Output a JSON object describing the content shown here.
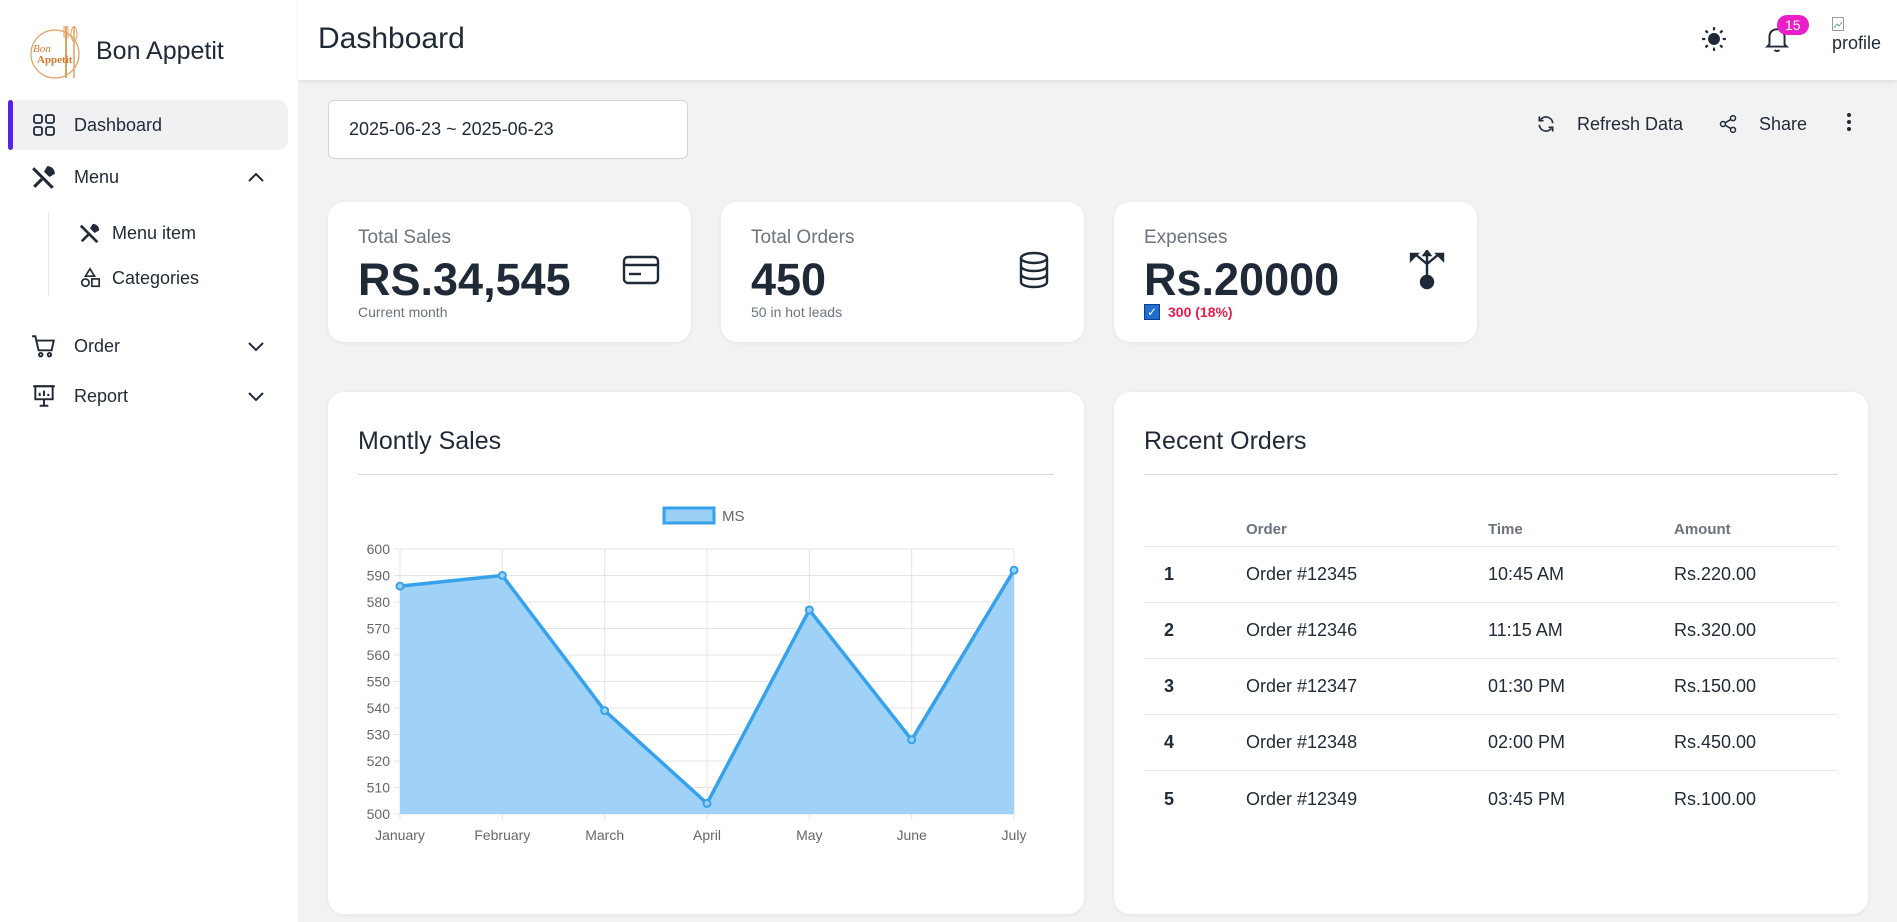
{
  "brand": {
    "name": "Bon Appetit",
    "logo_text_1": "Bon",
    "logo_text_2": "Appetit"
  },
  "sidebar": {
    "items": [
      {
        "label": "Dashboard",
        "icon": "grid-icon",
        "active": true
      },
      {
        "label": "Menu",
        "icon": "utensils-icon",
        "expanded": true
      },
      {
        "label": "Order",
        "icon": "cart-icon",
        "expanded": false
      },
      {
        "label": "Report",
        "icon": "presentation-icon",
        "expanded": false
      }
    ],
    "menu_sub": [
      {
        "label": "Menu item",
        "icon": "utensils-icon"
      },
      {
        "label": "Categories",
        "icon": "shapes-icon"
      }
    ]
  },
  "header": {
    "title": "Dashboard",
    "notifications_count": "15",
    "avatar_alt": "profile",
    "icons": [
      "sun-icon",
      "bell-icon"
    ]
  },
  "toolbar": {
    "date_range": "2025-06-23 ~ 2025-06-23",
    "refresh_label": "Refresh Data",
    "share_label": "Share"
  },
  "stats": {
    "sales": {
      "label": "Total Sales",
      "value": "RS.34,545",
      "sub": "Current month"
    },
    "orders": {
      "label": "Total Orders",
      "value": "450",
      "sub": "50 in hot leads"
    },
    "expenses": {
      "label": "Expenses",
      "value": "Rs.20000",
      "delta": "300 (18%)"
    }
  },
  "sales_card": {
    "title": "Montly Sales"
  },
  "orders_card": {
    "title": "Recent Orders",
    "columns": [
      "",
      "Order",
      "Time",
      "Amount"
    ],
    "rows": [
      [
        "1",
        "Order #12345",
        "10:45 AM",
        "Rs.220.00"
      ],
      [
        "2",
        "Order #12346",
        "11:15 AM",
        "Rs.320.00"
      ],
      [
        "3",
        "Order #12347",
        "01:30 PM",
        "Rs.150.00"
      ],
      [
        "4",
        "Order #12348",
        "02:00 PM",
        "Rs.450.00"
      ],
      [
        "5",
        "Order #12349",
        "03:45 PM",
        "Rs.100.00"
      ]
    ]
  },
  "colors": {
    "accent": "#5b21e6",
    "badge": "#e91ec9",
    "chart_line": "#36a2eb",
    "chart_fill": "#9ad0f5",
    "negative": "#e11d48"
  },
  "chart_data": {
    "type": "area",
    "categories": [
      "January",
      "February",
      "March",
      "April",
      "May",
      "June",
      "July"
    ],
    "series": [
      {
        "name": "MS",
        "values": [
          586,
          590,
          539,
          504,
          577,
          528,
          592
        ]
      }
    ],
    "ylim": [
      500,
      600
    ],
    "yticks": [
      600,
      590,
      580,
      570,
      560,
      550,
      540,
      530,
      520,
      510,
      500
    ],
    "grid": true,
    "legend": "top"
  }
}
